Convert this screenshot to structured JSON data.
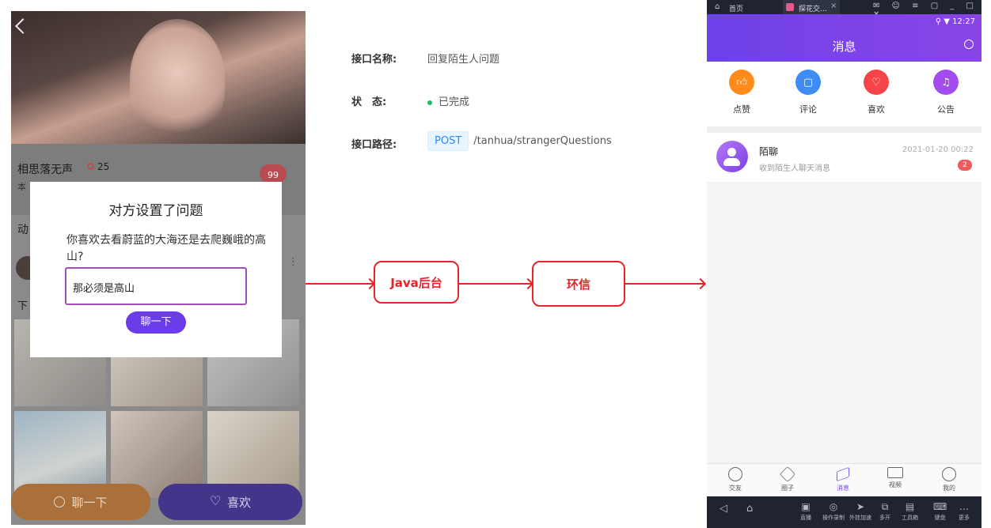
{
  "left_phone": {
    "profile_name": "相思落无声",
    "score": "25",
    "badge": "99",
    "profile_sub": "本",
    "tab_label": "动",
    "text_fragment": "下",
    "dialog": {
      "title": "对方设置了问题",
      "question": "你喜欢去看蔚蓝的大海还是去爬巍峨的高山?",
      "answer": "那必须是高山",
      "button": "聊一下"
    },
    "bottom_buttons": {
      "chat": "聊一下",
      "like": "喜欢"
    }
  },
  "api": {
    "name_label": "接口名称:",
    "name_value": "回复陌生人问题",
    "status_label": "状　态:",
    "status_value": "已完成",
    "path_label": "接口路径:",
    "method": "POST",
    "path": "/tanhua/strangerQuestions",
    "status_color": "#19be6b"
  },
  "flow": {
    "box1": "Java后台",
    "box2": "环信",
    "color": "#e8232a"
  },
  "right_phone": {
    "top_tabs": {
      "home": "首页",
      "app": "探花交...",
      "close": "×"
    },
    "status_time": "12:27",
    "title": "消息",
    "quick_actions": [
      {
        "label": "点赞",
        "icon": "thumbs-up-icon"
      },
      {
        "label": "评论",
        "icon": "comment-icon"
      },
      {
        "label": "喜欢",
        "icon": "heart-icon"
      },
      {
        "label": "公告",
        "icon": "bell-icon"
      }
    ],
    "message": {
      "name": "陌聊",
      "preview": "收到陌生人聊天消息",
      "time": "2021-01-20 00:22",
      "badge": "2"
    },
    "nav": [
      {
        "label": "交友"
      },
      {
        "label": "圈子"
      },
      {
        "label": "消息"
      },
      {
        "label": "视频"
      },
      {
        "label": "我的"
      }
    ],
    "sys_tools": [
      {
        "label": "直播"
      },
      {
        "label": "操作录制"
      },
      {
        "label": "外挂加速"
      },
      {
        "label": "多开"
      },
      {
        "label": "工具箱"
      },
      {
        "label": "键盘"
      },
      {
        "label": "更多"
      }
    ],
    "accent": "#6d42e9"
  }
}
